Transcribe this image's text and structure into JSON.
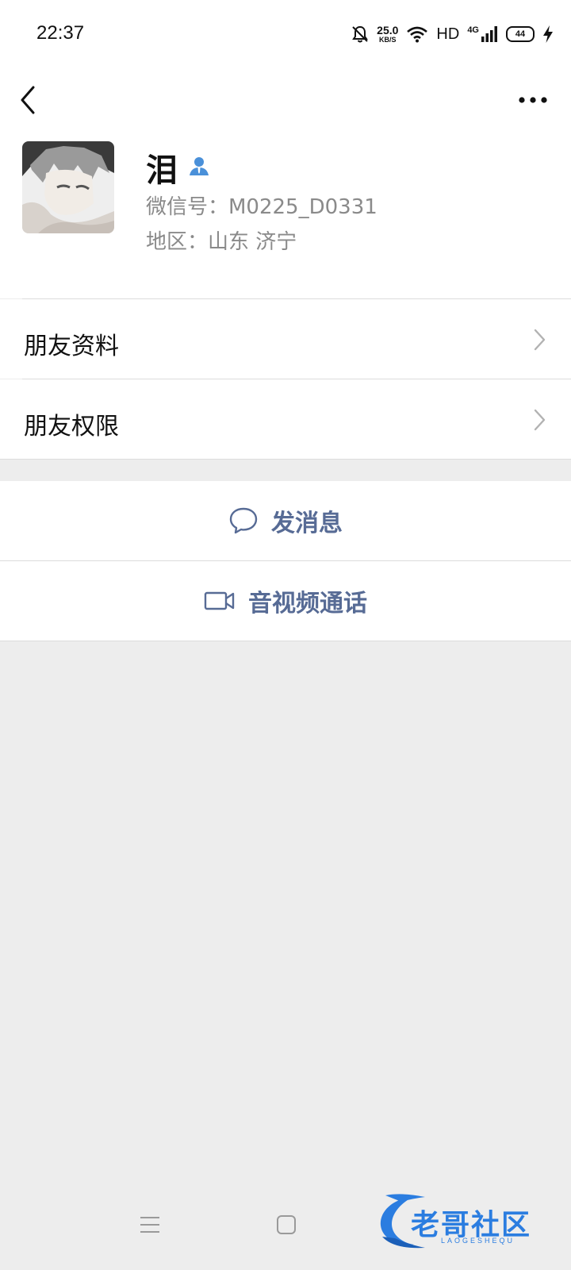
{
  "status_bar": {
    "time": "22:37",
    "net_speed_value": "25.0",
    "net_speed_unit": "KB/S",
    "network_label": "HD",
    "cellular_label": "4G",
    "battery_level": "44",
    "icons": [
      "bell-muted-icon",
      "wifi-icon",
      "cellular-signal-icon",
      "battery-icon",
      "charging-bolt-icon"
    ]
  },
  "nav": {
    "back_icon": "chevron-left-icon",
    "more_icon": "more-horizontal-icon"
  },
  "profile": {
    "name": "泪",
    "badge_icon": "person-badge-icon",
    "wechat_id_line": "微信号：M0225_D0331",
    "region_line": "地区：山东  济宁"
  },
  "menu": {
    "friend_info": "朋友资料",
    "friend_permissions": "朋友权限"
  },
  "actions": {
    "send_message": "发消息",
    "av_call": "音视频通话",
    "accent_color": "#576b95"
  },
  "watermark": {
    "title": "老哥社区",
    "subtitle": "LAOGESHEQU"
  }
}
